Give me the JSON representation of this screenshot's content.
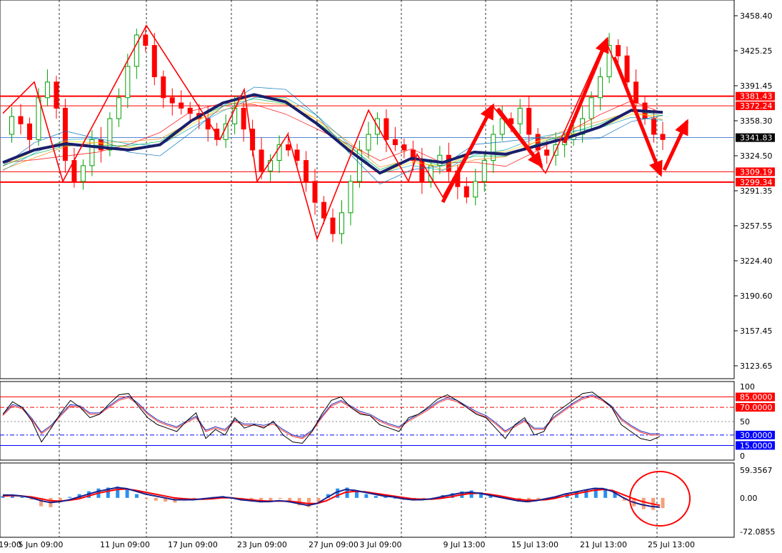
{
  "chart_data": [
    {
      "type": "candlestick",
      "panel": "price",
      "symbol": "",
      "ylim": [
        3100,
        3470
      ],
      "y_ticks": [
        "3458.40",
        "3425.25",
        "3391.45",
        "3358.30",
        "3324.50",
        "3291.35",
        "3257.55",
        "3224.40",
        "3190.60",
        "3157.45",
        "3123.65"
      ],
      "x_ticks": [
        "19:00",
        "5 Jun 09:00",
        "11 Jun 09:00",
        "17 Jun 09:00",
        "23 Jun 09:00",
        "27 Jun 09:00",
        "3 Jul 09:00",
        "9 Jul 13:00",
        "15 Jul 13:00",
        "21 Jul 13:00",
        "25 Jul 13:00"
      ],
      "current_price": {
        "value": 3341.83,
        "label": "3341.83"
      },
      "levels": [
        {
          "value": 3381.43,
          "label": "3381.43",
          "color": "#ff0000"
        },
        {
          "value": 3372.24,
          "label": "3372.24",
          "color": "#ff0000"
        },
        {
          "value": 3309.19,
          "label": "3309.19",
          "color": "#ff0000"
        },
        {
          "value": 3299.34,
          "label": "3299.34",
          "color": "#ff0000"
        }
      ],
      "zigzag": [
        3365,
        3395,
        3300,
        3449,
        3340,
        3388,
        3300,
        3345,
        3245,
        3368,
        3300,
        3326,
        3285,
        3372,
        3308,
        3435,
        3306
      ],
      "close_path": [
        3345,
        3362,
        3355,
        3340,
        3380,
        3395,
        3370,
        3320,
        3300,
        3315,
        3340,
        3330,
        3360,
        3380,
        3410,
        3440,
        3430,
        3400,
        3380,
        3375,
        3370,
        3365,
        3360,
        3350,
        3340,
        3355,
        3370,
        3350,
        3330,
        3310,
        3320,
        3335,
        3330,
        3320,
        3300,
        3280,
        3265,
        3250,
        3270,
        3300,
        3330,
        3345,
        3360,
        3340,
        3335,
        3330,
        3320,
        3300,
        3315,
        3325,
        3310,
        3295,
        3285,
        3300,
        3320,
        3345,
        3360,
        3355,
        3370,
        3345,
        3330,
        3325,
        3335,
        3340,
        3345,
        3360,
        3380,
        3400,
        3430,
        3420,
        3395,
        3375,
        3360,
        3345,
        3340
      ],
      "ma_thick": [
        3318,
        3330,
        3336,
        3333,
        3330,
        3335,
        3358,
        3375,
        3383,
        3376,
        3355,
        3330,
        3308,
        3322,
        3318,
        3328,
        3326,
        3334,
        3342,
        3352,
        3368,
        3366
      ],
      "arrows": [
        {
          "from": [
            3285,
            0
          ],
          "to": [
            3372,
            0
          ]
        },
        {
          "from": [
            3372,
            0
          ],
          "to": [
            3308,
            0
          ]
        },
        {
          "from": [
            3306,
            0
          ],
          "to": [
            3435,
            0
          ]
        },
        {
          "from": [
            3435,
            0
          ],
          "to": [
            3306,
            0
          ]
        },
        {
          "from": [
            3306,
            0
          ],
          "to": [
            3360,
            0
          ]
        }
      ],
      "colors": {
        "bull": "#00a000",
        "bear": "#ff0000",
        "ma": "#1a1f6b",
        "zigzag": "#ff0000",
        "current": "#000000"
      }
    },
    {
      "type": "line",
      "panel": "stochastic",
      "ylim": [
        0,
        100
      ],
      "y_ticks": [
        "100",
        "50",
        "0"
      ],
      "levels": [
        {
          "value": 85,
          "label": "85.0000",
          "color": "#ff0000"
        },
        {
          "value": 70,
          "label": "70.0000",
          "color": "#ff0000"
        },
        {
          "value": 30,
          "label": "30.0000",
          "color": "#0000ff"
        },
        {
          "value": 15,
          "label": "15.0000",
          "color": "#0000ff"
        }
      ],
      "series_main": [
        60,
        78,
        70,
        50,
        20,
        40,
        62,
        80,
        70,
        55,
        60,
        75,
        88,
        90,
        72,
        55,
        45,
        40,
        35,
        50,
        62,
        25,
        38,
        30,
        55,
        40,
        45,
        40,
        50,
        30,
        20,
        18,
        35,
        60,
        80,
        85,
        70,
        60,
        58,
        45,
        40,
        35,
        55,
        60,
        70,
        82,
        88,
        80,
        70,
        60,
        55,
        40,
        25,
        45,
        55,
        30,
        35,
        60,
        70,
        80,
        90,
        92,
        82,
        70,
        45,
        35,
        25,
        22,
        28
      ],
      "series_signal": [
        58,
        72,
        68,
        52,
        32,
        42,
        58,
        72,
        70,
        60,
        60,
        70,
        80,
        84,
        74,
        60,
        50,
        44,
        40,
        48,
        55,
        35,
        40,
        36,
        50,
        44,
        44,
        42,
        46,
        36,
        28,
        25,
        35,
        55,
        72,
        78,
        70,
        62,
        58,
        50,
        44,
        40,
        50,
        58,
        66,
        76,
        82,
        78,
        70,
        62,
        56,
        46,
        34,
        42,
        50,
        38,
        38,
        54,
        64,
        74,
        82,
        86,
        80,
        70,
        52,
        42,
        34,
        30,
        30
      ]
    },
    {
      "type": "bar",
      "panel": "macd",
      "ylim": [
        -72.0855,
        59.3567
      ],
      "y_ticks": [
        "59.3567",
        "0.00",
        "-72.0855"
      ],
      "histogram": [
        4,
        6,
        2,
        -4,
        -18,
        -20,
        -8,
        2,
        8,
        14,
        20,
        22,
        24,
        18,
        8,
        -2,
        -6,
        -8,
        -10,
        -6,
        -4,
        -2,
        2,
        4,
        -2,
        -6,
        -8,
        -10,
        -6,
        -2,
        -10,
        -16,
        -20,
        -10,
        8,
        20,
        22,
        16,
        8,
        4,
        2,
        0,
        -4,
        -6,
        -4,
        0,
        6,
        10,
        14,
        16,
        12,
        6,
        2,
        -4,
        -8,
        -10,
        -6,
        -2,
        4,
        10,
        14,
        18,
        22,
        20,
        12,
        -6,
        -18,
        -24,
        -26,
        -22
      ],
      "macd_line": [
        6,
        6,
        4,
        0,
        -6,
        -10,
        -8,
        -4,
        2,
        8,
        14,
        18,
        22,
        20,
        14,
        8,
        4,
        0,
        -4,
        -4,
        -4,
        -2,
        0,
        2,
        0,
        -4,
        -6,
        -8,
        -8,
        -6,
        -8,
        -12,
        -16,
        -12,
        0,
        12,
        18,
        16,
        12,
        8,
        4,
        2,
        -2,
        -4,
        -4,
        -2,
        2,
        6,
        10,
        12,
        10,
        6,
        2,
        -2,
        -6,
        -8,
        -6,
        -2,
        2,
        8,
        12,
        16,
        20,
        20,
        14,
        2,
        -8,
        -14,
        -18,
        -20
      ],
      "signal_line": [
        4,
        5,
        4,
        2,
        -2,
        -6,
        -7,
        -5,
        -2,
        4,
        10,
        14,
        18,
        19,
        16,
        12,
        8,
        4,
        0,
        -2,
        -3,
        -3,
        -2,
        0,
        0,
        -2,
        -4,
        -6,
        -7,
        -7,
        -7,
        -9,
        -12,
        -12,
        -6,
        4,
        12,
        14,
        13,
        10,
        7,
        4,
        1,
        -2,
        -3,
        -3,
        -1,
        2,
        6,
        9,
        10,
        8,
        5,
        1,
        -3,
        -5,
        -5,
        -4,
        -1,
        4,
        8,
        12,
        16,
        18,
        16,
        8,
        0,
        -7,
        -12,
        -16
      ],
      "colors": {
        "pos": "#2b8ff0",
        "neg": "#f4a07a",
        "macd": "#1a1f8a",
        "signal": "#ff0000"
      }
    }
  ]
}
